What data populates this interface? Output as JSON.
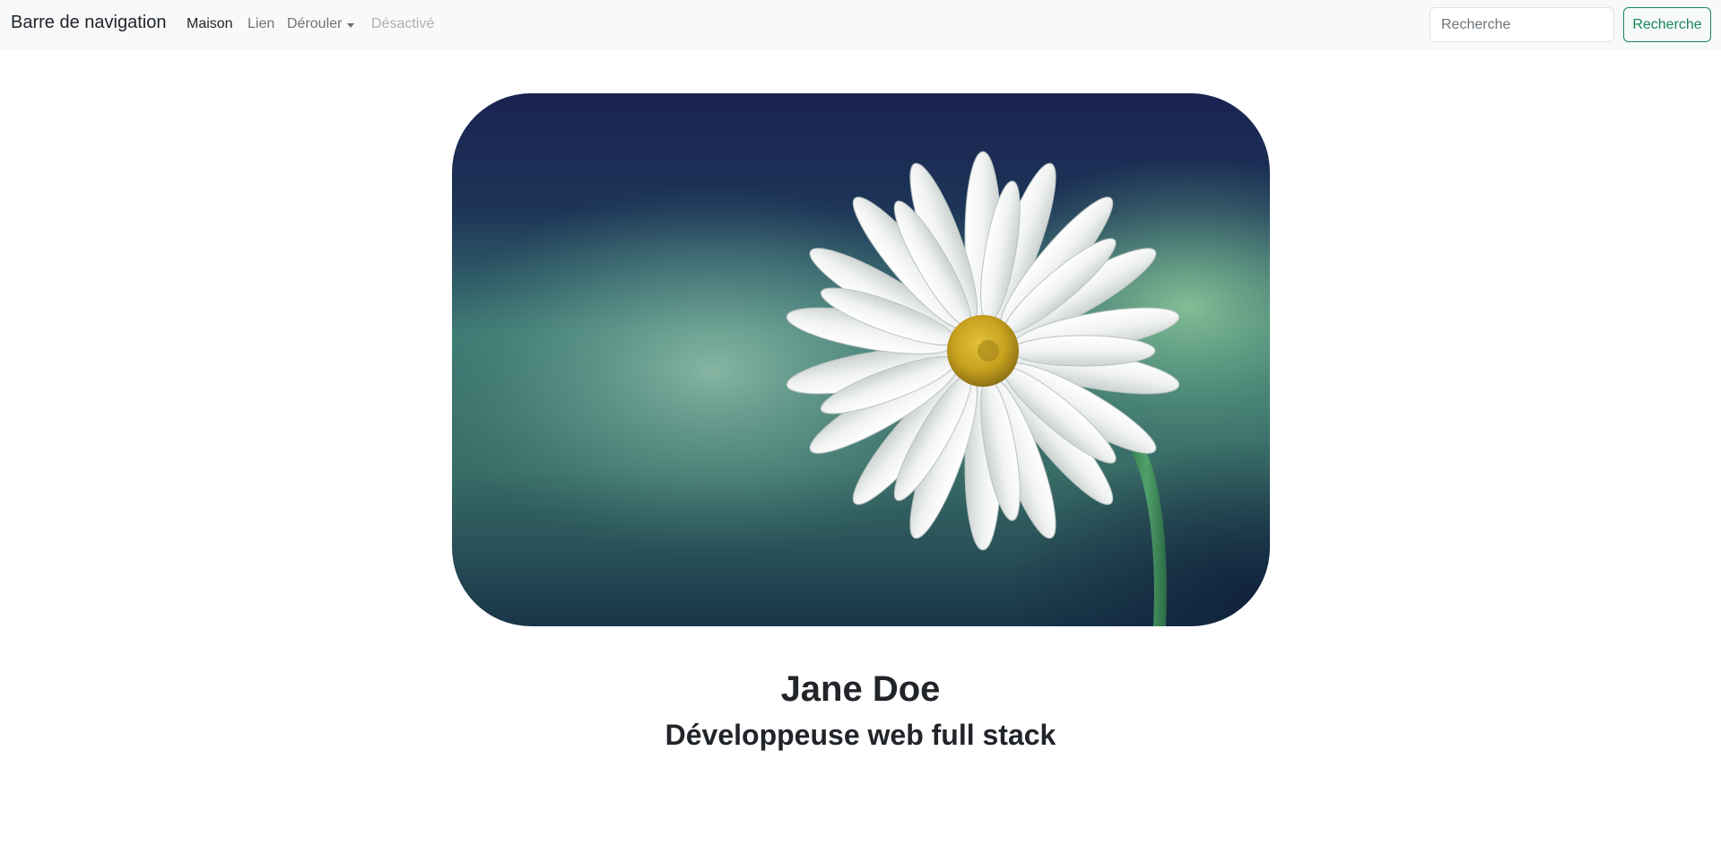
{
  "navbar": {
    "brand": "Barre de navigation",
    "items": [
      {
        "label": "Maison",
        "state": "active"
      },
      {
        "label": "Lien",
        "state": "normal"
      },
      {
        "label": "Dérouler",
        "state": "dropdown"
      },
      {
        "label": "Désactivé",
        "state": "disabled"
      }
    ],
    "search": {
      "placeholder": "Recherche",
      "button_label": "Recherche"
    }
  },
  "profile": {
    "name": "Jane Doe",
    "title": "Développeuse web full stack"
  },
  "colors": {
    "navbar_bg": "#f8f9fa",
    "success": "#198754",
    "text": "#212529",
    "muted_link": "rgba(0,0,0,0.55)",
    "disabled_link": "rgba(0,0,0,0.3)"
  },
  "icons": {
    "dropdown": "chevron-down-icon"
  }
}
